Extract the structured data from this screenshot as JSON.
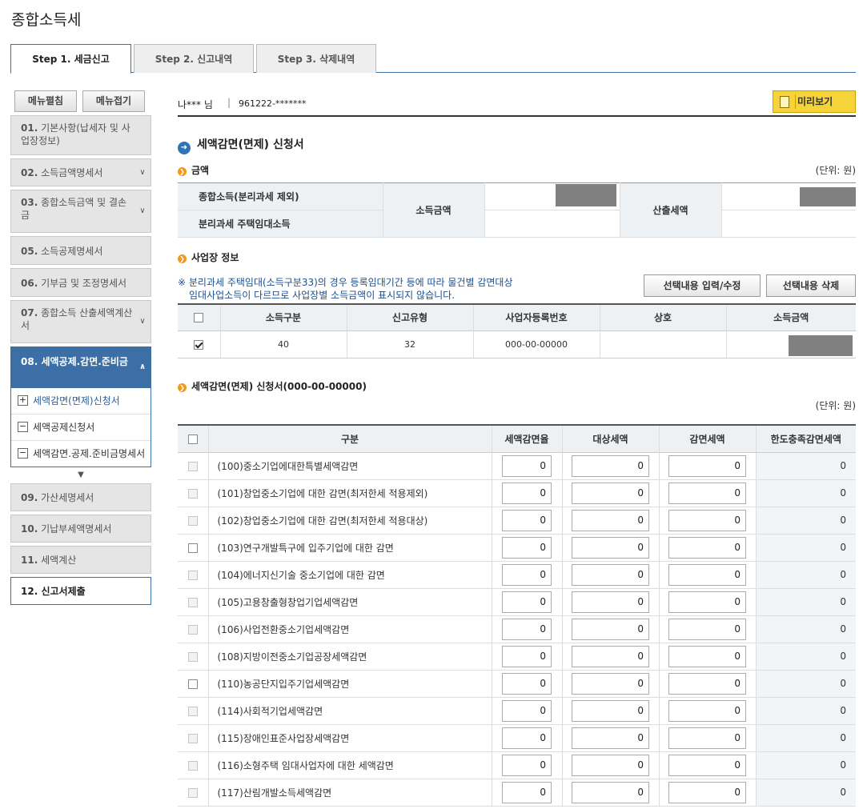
{
  "page_title": "종합소득세",
  "tabs": [
    {
      "label": "Step 1. 세금신고"
    },
    {
      "label": "Step 2. 신고내역"
    },
    {
      "label": "Step 3. 삭제내역"
    }
  ],
  "sidebar": {
    "expand_label": "메뉴펼침",
    "collapse_label": "메뉴접기",
    "items": [
      {
        "num": "01.",
        "label": "기본사항(납세자 및 사업장정보)"
      },
      {
        "num": "02.",
        "label": "소득금액명세서"
      },
      {
        "num": "03.",
        "label": "종합소득금액 및 결손금"
      },
      {
        "num": "05.",
        "label": "소득공제명세서"
      },
      {
        "num": "06.",
        "label": "기부금 및 조정명세서"
      },
      {
        "num": "07.",
        "label": "종합소득 산출세액계산서"
      },
      {
        "num": "08.",
        "label": "세액공제.감면.준비금"
      },
      {
        "num": "09.",
        "label": "가산세명세서"
      },
      {
        "num": "10.",
        "label": "기납부세액명세서"
      },
      {
        "num": "11.",
        "label": "세액계산"
      },
      {
        "num": "12.",
        "label": "신고서제출"
      }
    ],
    "subitems": [
      {
        "label": "세액감면(면제)신청서",
        "box": "+"
      },
      {
        "label": "세액공제신청서",
        "box": "−"
      },
      {
        "label": "세액감면.공제.준비금명세서",
        "box": "−"
      }
    ]
  },
  "user": {
    "name": "나*** 님",
    "sep": "|",
    "id": "961222-*******",
    "preview_label": "미리보기"
  },
  "section_title": "세액감면(면제) 신청서",
  "amount": {
    "heading": "금액",
    "unit": "(단위: 원)",
    "row1_label": "종합소득(분리과세 제외)",
    "row2_label": "분리과세 주택임대소득",
    "income_label": "소득금액",
    "tax_label": "산출세액"
  },
  "business": {
    "heading": "사업장 정보",
    "note_line1": "※ 분리과세 주택임대(소득구분33)의 경우 등록임대기간 등에 따라 물건별 감면대상",
    "note_line2": "임대사업소득이 다르므로 사업장별 소득금액이 표시되지 않습니다.",
    "edit_btn": "선택내용 입력/수정",
    "delete_btn": "선택내용 삭제",
    "headers": [
      "소득구분",
      "신고유형",
      "사업자등록번호",
      "상호",
      "소득금액"
    ],
    "row": {
      "income_type": "40",
      "report_type": "32",
      "reg_no": "000-00-00000",
      "name": ""
    }
  },
  "reduction": {
    "heading": "세액감면(면제) 신청서(000-00-00000)",
    "unit": "(단위: 원)",
    "headers": [
      "구분",
      "세액감면율",
      "대상세액",
      "감면세액",
      "한도충족감면세액"
    ],
    "rows": [
      {
        "name": "(100)중소기업에대한특별세액감면",
        "rate": "0",
        "target": "0",
        "reduced": "0",
        "limit": "0",
        "enabled": false
      },
      {
        "name": "(101)창업중소기업에 대한 감면(최저한세 적용제외)",
        "rate": "0",
        "target": "0",
        "reduced": "0",
        "limit": "0",
        "enabled": false
      },
      {
        "name": "(102)창업중소기업에 대한 감면(최저한세 적용대상)",
        "rate": "0",
        "target": "0",
        "reduced": "0",
        "limit": "0",
        "enabled": false
      },
      {
        "name": "(103)연구개발특구에 입주기업에 대한 감면",
        "rate": "0",
        "target": "0",
        "reduced": "0",
        "limit": "0",
        "enabled": true
      },
      {
        "name": "(104)에너지신기술 중소기업에 대한 감면",
        "rate": "0",
        "target": "0",
        "reduced": "0",
        "limit": "0",
        "enabled": false
      },
      {
        "name": "(105)고용창출형창업기업세액감면",
        "rate": "0",
        "target": "0",
        "reduced": "0",
        "limit": "0",
        "enabled": false
      },
      {
        "name": "(106)사업전환중소기업세액감면",
        "rate": "0",
        "target": "0",
        "reduced": "0",
        "limit": "0",
        "enabled": false
      },
      {
        "name": "(108)지방이전중소기업공장세액감면",
        "rate": "0",
        "target": "0",
        "reduced": "0",
        "limit": "0",
        "enabled": false
      },
      {
        "name": "(110)농공단지입주기업세액감면",
        "rate": "0",
        "target": "0",
        "reduced": "0",
        "limit": "0",
        "enabled": true
      },
      {
        "name": "(114)사회적기업세액감면",
        "rate": "0",
        "target": "0",
        "reduced": "0",
        "limit": "0",
        "enabled": false
      },
      {
        "name": "(115)장애인표준사업장세액감면",
        "rate": "0",
        "target": "0",
        "reduced": "0",
        "limit": "0",
        "enabled": false
      },
      {
        "name": "(116)소형주택 임대사업자에 대한 세액감면",
        "rate": "0",
        "target": "0",
        "reduced": "0",
        "limit": "0",
        "enabled": false
      },
      {
        "name": "(117)산림개발소득세액감면",
        "rate": "0",
        "target": "0",
        "reduced": "0",
        "limit": "0",
        "enabled": false
      }
    ]
  },
  "colors": {
    "accent": "#3d6fa7",
    "preview": "#f7d33a",
    "bullet": "#f29a1e"
  }
}
